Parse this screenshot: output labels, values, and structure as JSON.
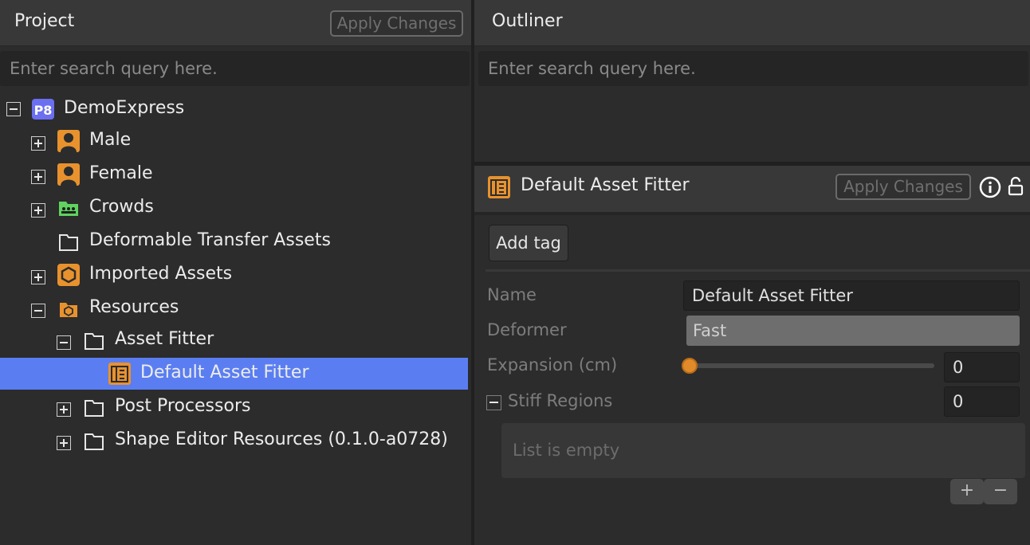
{
  "project": {
    "title": "Project",
    "apply_label": "Apply Changes",
    "search_placeholder": "Enter search query here.",
    "tree": [
      {
        "label": "DemoExpress",
        "icon": "p8-project-icon",
        "expander": "minus"
      },
      {
        "label": "Male",
        "icon": "person-icon",
        "expander": "plus"
      },
      {
        "label": "Female",
        "icon": "person-icon",
        "expander": "plus"
      },
      {
        "label": "Crowds",
        "icon": "crowds-icon",
        "expander": "plus"
      },
      {
        "label": "Deformable Transfer Assets",
        "icon": "folder-icon",
        "expander": "none"
      },
      {
        "label": "Imported Assets",
        "icon": "hexagon-icon",
        "expander": "plus"
      },
      {
        "label": "Resources",
        "icon": "resource-folder-icon",
        "expander": "minus"
      },
      {
        "label": "Asset Fitter",
        "icon": "folder-icon",
        "expander": "minus"
      },
      {
        "label": "Default Asset Fitter",
        "icon": "asset-fitter-icon",
        "expander": "none",
        "selected": true
      },
      {
        "label": "Post Processors",
        "icon": "folder-icon",
        "expander": "plus"
      },
      {
        "label": "Shape Editor Resources (0.1.0-a0728)",
        "icon": "folder-icon",
        "expander": "plus"
      }
    ]
  },
  "outliner": {
    "title": "Outliner",
    "search_placeholder": "Enter search query here."
  },
  "inspector": {
    "title": "Default Asset Fitter",
    "apply_label": "Apply Changes",
    "add_tag_label": "Add tag",
    "name_label": "Name",
    "name_value": "Default Asset Fitter",
    "deformer_label": "Deformer",
    "deformer_value": "Fast",
    "expansion_label": "Expansion (cm)",
    "expansion_value": "0",
    "expansion_fraction": 0,
    "stiff_label": "Stiff Regions",
    "stiff_count": "0",
    "list_empty_text": "List is empty",
    "add_symbol": "+",
    "remove_symbol": "−"
  },
  "colors": {
    "selection": "#5a7ef2",
    "accent_orange": "#e8922e",
    "p8_badge": "#6b6ff0",
    "crowds_green": "#5fd35f"
  }
}
